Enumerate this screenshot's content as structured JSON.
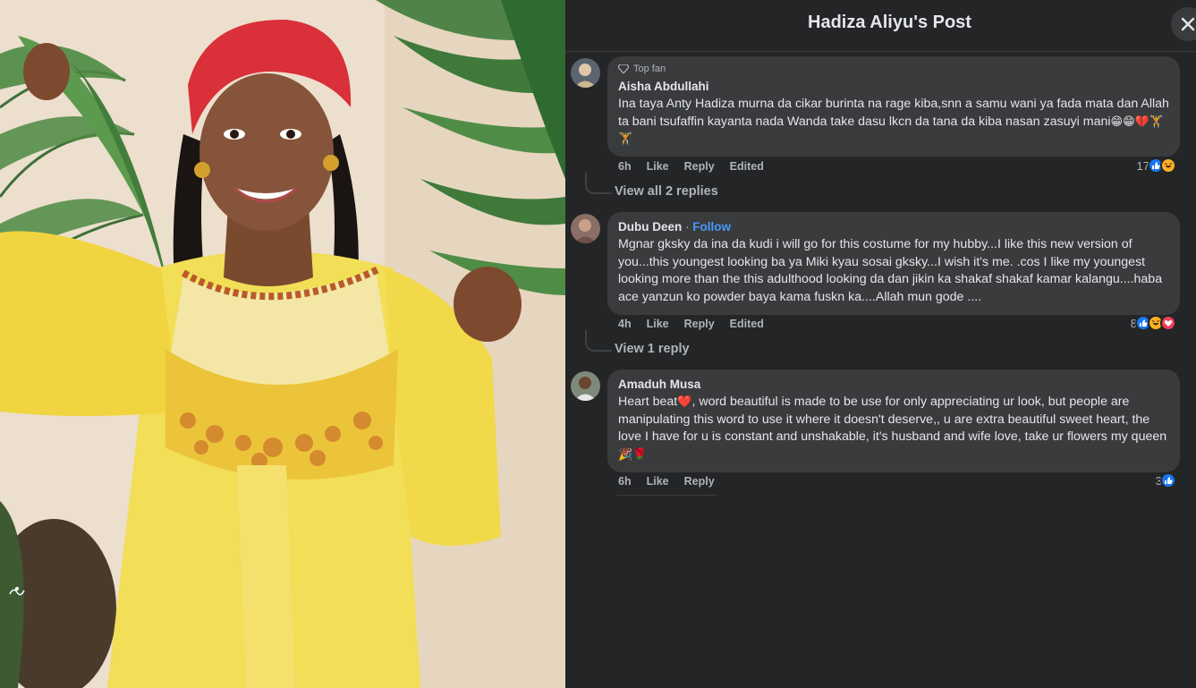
{
  "header": {
    "title": "Hadiza Aliyu's Post",
    "close_icon": "close-icon"
  },
  "colors": {
    "panel_bg": "#242526",
    "bubble_bg": "#3a3b3c",
    "text_primary": "#e4e6eb",
    "text_secondary": "#b0b3b8",
    "link_blue": "#4599ff",
    "like_blue": "#1877f2"
  },
  "photo": {
    "description_icon": "photo-of-woman-in-yellow-dress",
    "watermark_icon": "watermark-logo"
  },
  "comments": [
    {
      "badge": "Top fan",
      "badge_icon": "diamond-icon",
      "author": "Aisha Abdullahi",
      "text": "Ina taya Anty Hadiza murna da cikar burinta na rage kiba,snn a samu wani ya fada mata dan Allah ta bani tsufaffin kayanta nada Wanda take dasu lkcn da tana da kiba nasan zasuyi mani",
      "emojis": "😁😁💔🏋🏋",
      "time": "6h",
      "like_label": "Like",
      "reply_label": "Reply",
      "edited_label": "Edited",
      "reaction_count": "17",
      "replies_label": "View all 2 replies"
    },
    {
      "author": "Dubu Deen",
      "separator": " · ",
      "follow_label": "Follow",
      "text": "Mgnar gksky da ina da kudi i will go for this costume for my hubby...I like this new version of you...this youngest looking ba ya Miki kyau sosai gksky...I wish it's me. .cos I like my youngest looking more than the this adulthood looking da dan jikin ka shakaf shakaf kamar kalangu....haba ace yanzun ko powder baya kama fuskn ka....Allah mun gode ....",
      "time": "4h",
      "like_label": "Like",
      "reply_label": "Reply",
      "edited_label": "Edited",
      "reaction_count": "8",
      "replies_label": "View 1 reply"
    },
    {
      "author": "Amaduh Musa",
      "text_part1": "Heart beat",
      "heart_emoji": "❤️",
      "text_part2": ", word beautiful is made to be use for only appreciating ur look, but people are manipulating this word to use it where it doesn't deserve,, u are extra beautiful sweet heart, the love I have for u is constant and unshakable, it's husband and wife love, take ur flowers my queen",
      "end_emojis": "🎉🌹",
      "time": "6h",
      "like_label": "Like",
      "reply_label": "Reply",
      "reaction_count": "3"
    }
  ]
}
